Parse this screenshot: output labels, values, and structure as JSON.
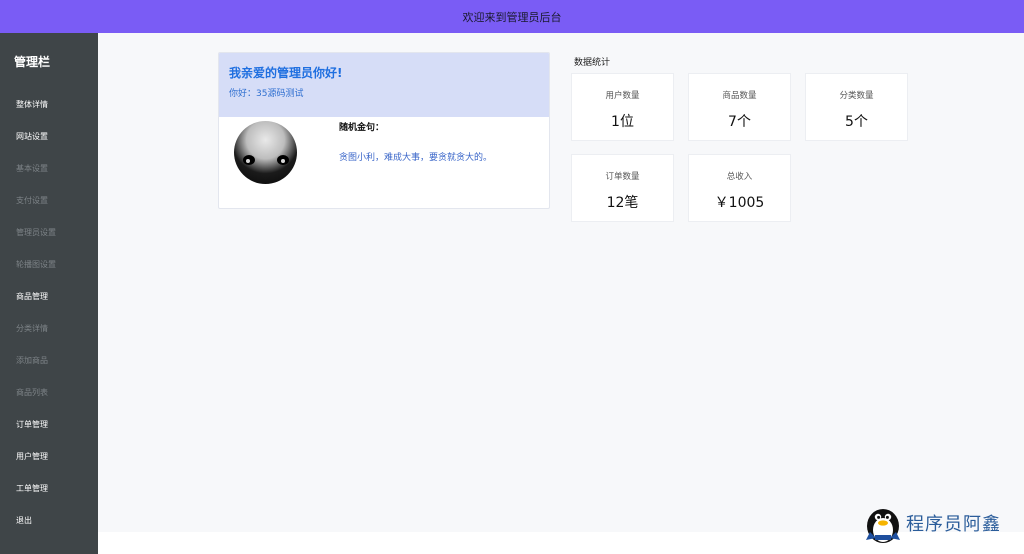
{
  "header": {
    "title": "欢迎来到管理员后台",
    "bg_color": "#7a5cf5"
  },
  "sidebar": {
    "title": "管理栏",
    "bg_color": "#3f4548",
    "items": [
      {
        "label": "整体详情",
        "active": true
      },
      {
        "label": "网站设置",
        "active": true
      },
      {
        "label": "基本设置",
        "active": false
      },
      {
        "label": "支付设置",
        "active": false
      },
      {
        "label": "管理员设置",
        "active": false
      },
      {
        "label": "轮播图设置",
        "active": false
      },
      {
        "label": "商品管理",
        "active": true
      },
      {
        "label": "分类详情",
        "active": false
      },
      {
        "label": "添加商品",
        "active": false
      },
      {
        "label": "商品列表",
        "active": false
      },
      {
        "label": "订单管理",
        "active": true
      },
      {
        "label": "用户管理",
        "active": true
      },
      {
        "label": "工单管理",
        "active": true
      },
      {
        "label": "退出",
        "active": true
      }
    ]
  },
  "greeting": {
    "title": "我亲爱的管理员你好!",
    "subtitle": "你好：35源码测试",
    "quote_label": "随机金句：",
    "quote_text": "贪图小利，难成大事，要贪就贪大的。",
    "avatar_icon": "black-cat-avatar"
  },
  "stats": {
    "title": "数据统计",
    "cards": [
      {
        "label": "用户数量",
        "value": "1位"
      },
      {
        "label": "商品数量",
        "value": "7个"
      },
      {
        "label": "分类数量",
        "value": "5个"
      },
      {
        "label": "订单数量",
        "value": "12笔"
      },
      {
        "label": "总收入",
        "value": "￥1005"
      }
    ]
  },
  "watermark": {
    "text": "程序员阿鑫",
    "icon": "penguin-icon"
  }
}
